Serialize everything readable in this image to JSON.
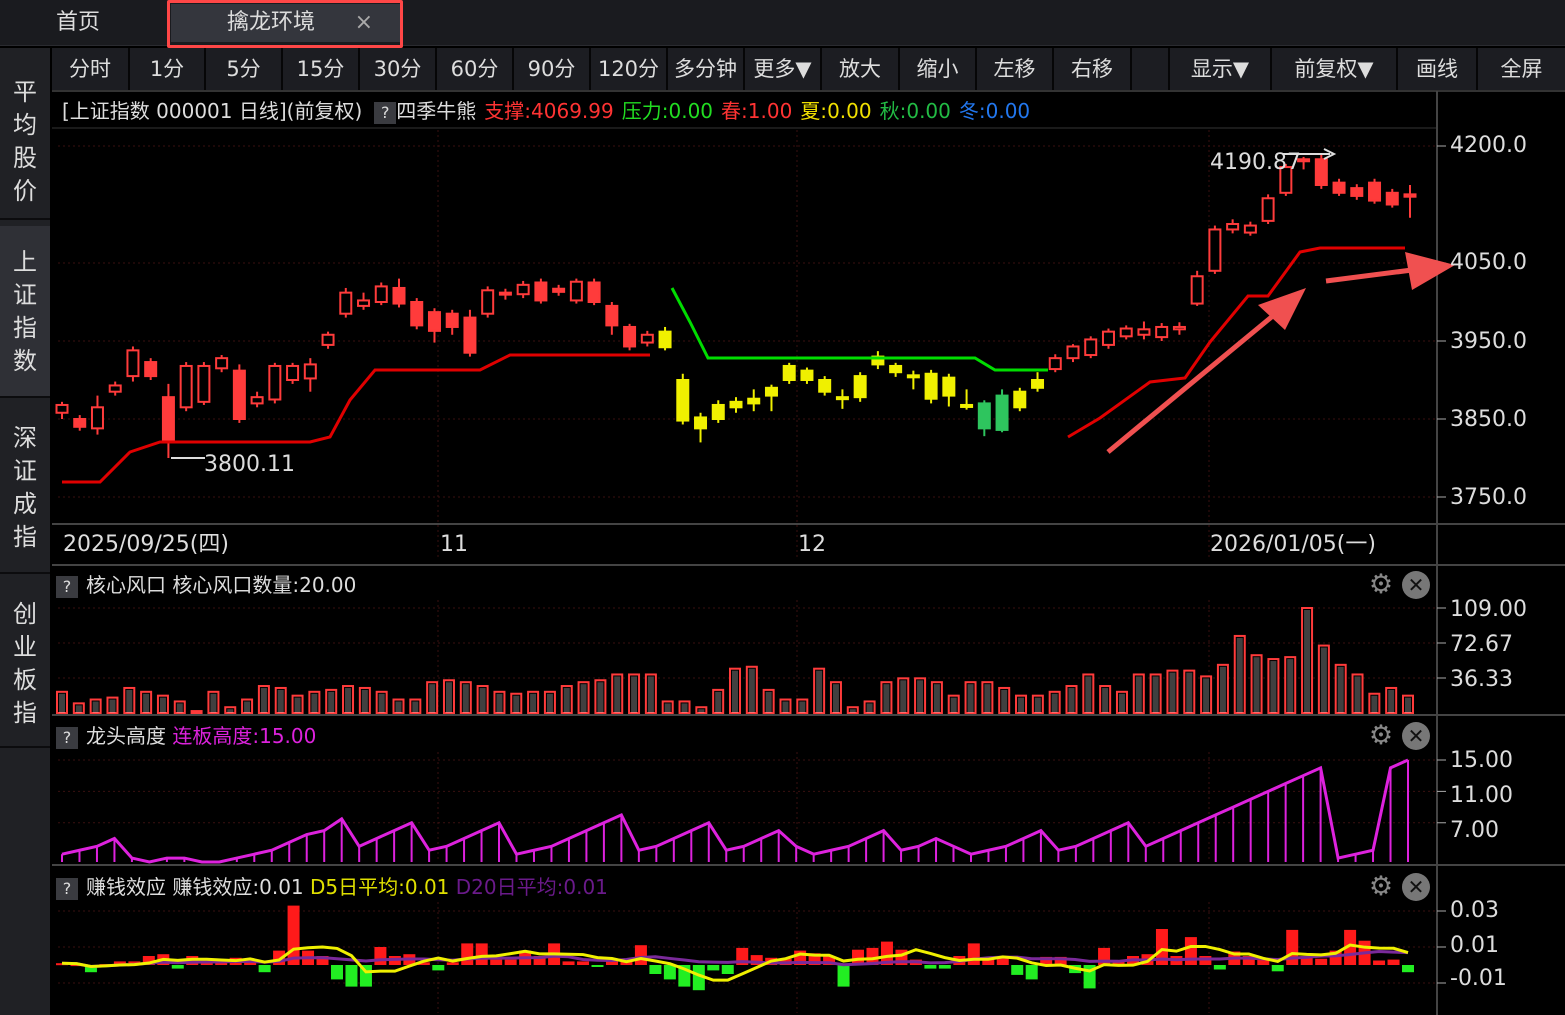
{
  "tabs": {
    "home": "首页",
    "active": "擒龙环境",
    "close": "×"
  },
  "sidebar": [
    {
      "label": "平均股价",
      "active": false
    },
    {
      "label": "上证指数",
      "active": true
    },
    {
      "label": "深证成指",
      "active": false
    },
    {
      "label": "创业板指",
      "active": false
    }
  ],
  "toolbar": [
    "分时",
    "1分",
    "5分",
    "15分",
    "30分",
    "60分",
    "90分",
    "120分",
    "多分钟",
    "更多▼",
    "放大",
    "缩小",
    "左移",
    "右移",
    "",
    "显示▼",
    "前复权▼",
    "画线",
    "全屏"
  ],
  "main": {
    "title": "[上证指数 000001 日线]",
    "adjust": "(前复权)",
    "indicator": "四季牛熊",
    "support_label": "支撑:",
    "support_value": "4069.99",
    "pressure_label": "压力:",
    "pressure_value": "0.00",
    "spring_label": "春:",
    "spring_value": "1.00",
    "summer_label": "夏:",
    "summer_value": "0.00",
    "autumn_label": "秋:",
    "autumn_value": "0.00",
    "winter_label": "冬:",
    "winter_value": "0.00",
    "y_ticks": [
      "4200.0",
      "4050.0",
      "3950.0",
      "3850.0",
      "3750.0"
    ],
    "high_annotation": "4190.87",
    "low_annotation": "3800.11",
    "dates": [
      "2025/09/25(四)",
      "11",
      "12",
      "2026/01/05(一)"
    ]
  },
  "panel_core": {
    "name": "核心风口",
    "label": "核心风口数量:",
    "value": "20.00",
    "y_ticks": [
      "109.00",
      "72.67",
      "36.33"
    ]
  },
  "panel_dragon": {
    "name": "龙头高度",
    "label": "连板高度:",
    "value": "15.00",
    "y_ticks": [
      "15.00",
      "11.00",
      "7.00"
    ]
  },
  "panel_money": {
    "name": "赚钱效应",
    "label": "赚钱效应:",
    "value": "0.01",
    "d5_label": "D5日平均:",
    "d5_value": "0.01",
    "d20_label": "D20日平均:",
    "d20_value": "0.01",
    "y_ticks": [
      "0.03",
      "0.01",
      "-0.01"
    ]
  },
  "colors": {
    "up": "#ff3b3b",
    "down": "#00e5e5",
    "yellow": "#f0f000",
    "green": "#2ec55e",
    "support": "#e00000",
    "pressure": "#00dd00",
    "magenta": "#dd22dd",
    "arrow": "#f05050"
  },
  "chart_data": [
    {
      "type": "candlestick",
      "title": "[上证指数 000001 日线]",
      "ylim": [
        3720,
        4230
      ],
      "y_ticks": [
        4200,
        4050,
        3950,
        3850,
        3750
      ],
      "dates": [
        "2025/09/25(四)",
        "11",
        "12",
        "2026/01/05(一)"
      ],
      "candles": [
        {
          "o": 3858,
          "c": 3868,
          "h": 3872,
          "l": 3850,
          "s": "up"
        },
        {
          "o": 3850,
          "c": 3840,
          "h": 3855,
          "l": 3835,
          "s": "down"
        },
        {
          "o": 3838,
          "c": 3865,
          "h": 3880,
          "l": 3830,
          "s": "up"
        },
        {
          "o": 3885,
          "c": 3893,
          "h": 3898,
          "l": 3880,
          "s": "up"
        },
        {
          "o": 3905,
          "c": 3938,
          "h": 3943,
          "l": 3898,
          "s": "up"
        },
        {
          "o": 3923,
          "c": 3905,
          "h": 3928,
          "l": 3900,
          "s": "down"
        },
        {
          "o": 3878,
          "c": 3820,
          "h": 3895,
          "l": 3800,
          "s": "down"
        },
        {
          "o": 3865,
          "c": 3918,
          "h": 3923,
          "l": 3860,
          "s": "up"
        },
        {
          "o": 3872,
          "c": 3918,
          "h": 3923,
          "l": 3868,
          "s": "up"
        },
        {
          "o": 3915,
          "c": 3928,
          "h": 3932,
          "l": 3910,
          "s": "up"
        },
        {
          "o": 3912,
          "c": 3850,
          "h": 3920,
          "l": 3845,
          "s": "down"
        },
        {
          "o": 3870,
          "c": 3878,
          "h": 3885,
          "l": 3865,
          "s": "up"
        },
        {
          "o": 3875,
          "c": 3918,
          "h": 3922,
          "l": 3870,
          "s": "up"
        },
        {
          "o": 3900,
          "c": 3918,
          "h": 3922,
          "l": 3895,
          "s": "up"
        },
        {
          "o": 3902,
          "c": 3920,
          "h": 3928,
          "l": 3885,
          "s": "up"
        },
        {
          "o": 3945,
          "c": 3958,
          "h": 3962,
          "l": 3940,
          "s": "up"
        },
        {
          "o": 3985,
          "c": 4012,
          "h": 4018,
          "l": 3980,
          "s": "up"
        },
        {
          "o": 3995,
          "c": 4002,
          "h": 4012,
          "l": 3990,
          "s": "up"
        },
        {
          "o": 4000,
          "c": 4020,
          "h": 4025,
          "l": 3996,
          "s": "up"
        },
        {
          "o": 4018,
          "c": 3998,
          "h": 4030,
          "l": 3993,
          "s": "down"
        },
        {
          "o": 4000,
          "c": 3970,
          "h": 4005,
          "l": 3965,
          "s": "down"
        },
        {
          "o": 3987,
          "c": 3963,
          "h": 3992,
          "l": 3948,
          "s": "down"
        },
        {
          "o": 3985,
          "c": 3968,
          "h": 3990,
          "l": 3958,
          "s": "down"
        },
        {
          "o": 3980,
          "c": 3935,
          "h": 3990,
          "l": 3930,
          "s": "up"
        },
        {
          "o": 3985,
          "c": 4015,
          "h": 4020,
          "l": 3980,
          "s": "up"
        },
        {
          "o": 4010,
          "c": 4012,
          "h": 4017,
          "l": 4003,
          "s": "up"
        },
        {
          "o": 4010,
          "c": 4022,
          "h": 4027,
          "l": 4005,
          "s": "up"
        },
        {
          "o": 4025,
          "c": 4002,
          "h": 4030,
          "l": 3998,
          "s": "down"
        },
        {
          "o": 4017,
          "c": 4013,
          "h": 4022,
          "l": 4008,
          "s": "up"
        },
        {
          "o": 4002,
          "c": 4026,
          "h": 4030,
          "l": 3998,
          "s": "up"
        },
        {
          "o": 4025,
          "c": 4000,
          "h": 4030,
          "l": 3996,
          "s": "down"
        },
        {
          "o": 3995,
          "c": 3970,
          "h": 4000,
          "l": 3958,
          "s": "down"
        },
        {
          "o": 3968,
          "c": 3943,
          "h": 3972,
          "l": 3938,
          "s": "down"
        },
        {
          "o": 3948,
          "c": 3958,
          "h": 3963,
          "l": 3943,
          "s": "up"
        },
        {
          "o": 3942,
          "c": 3962,
          "h": 3968,
          "l": 3938,
          "s": "yellow"
        },
        {
          "o": 3900,
          "c": 3848,
          "h": 3908,
          "l": 3843,
          "s": "yellow"
        },
        {
          "o": 3838,
          "c": 3852,
          "h": 3858,
          "l": 3820,
          "s": "yellow"
        },
        {
          "o": 3850,
          "c": 3868,
          "h": 3874,
          "l": 3845,
          "s": "yellow"
        },
        {
          "o": 3872,
          "c": 3865,
          "h": 3878,
          "l": 3858,
          "s": "yellow"
        },
        {
          "o": 3870,
          "c": 3876,
          "h": 3888,
          "l": 3860,
          "s": "yellow"
        },
        {
          "o": 3880,
          "c": 3890,
          "h": 3894,
          "l": 3860,
          "s": "yellow"
        },
        {
          "o": 3900,
          "c": 3918,
          "h": 3922,
          "l": 3895,
          "s": "yellow"
        },
        {
          "o": 3912,
          "c": 3900,
          "h": 3916,
          "l": 3895,
          "s": "yellow"
        },
        {
          "o": 3900,
          "c": 3885,
          "h": 3905,
          "l": 3880,
          "s": "yellow"
        },
        {
          "o": 3878,
          "c": 3876,
          "h": 3888,
          "l": 3863,
          "s": "yellow"
        },
        {
          "o": 3878,
          "c": 3905,
          "h": 3910,
          "l": 3872,
          "s": "yellow"
        },
        {
          "o": 3920,
          "c": 3930,
          "h": 3937,
          "l": 3914,
          "s": "yellow"
        },
        {
          "o": 3918,
          "c": 3910,
          "h": 3922,
          "l": 3904,
          "s": "yellow"
        },
        {
          "o": 3906,
          "c": 3906,
          "h": 3912,
          "l": 3888,
          "s": "yellow"
        },
        {
          "o": 3908,
          "c": 3876,
          "h": 3913,
          "l": 3870,
          "s": "yellow"
        },
        {
          "o": 3903,
          "c": 3880,
          "h": 3908,
          "l": 3866,
          "s": "yellow"
        },
        {
          "o": 3868,
          "c": 3868,
          "h": 3888,
          "l": 3862,
          "s": "yellow"
        },
        {
          "o": 3870,
          "c": 3838,
          "h": 3874,
          "l": 3828,
          "s": "green"
        },
        {
          "o": 3836,
          "c": 3880,
          "h": 3888,
          "l": 3833,
          "s": "green"
        },
        {
          "o": 3865,
          "c": 3885,
          "h": 3890,
          "l": 3860,
          "s": "yellow"
        },
        {
          "o": 3890,
          "c": 3900,
          "h": 3910,
          "l": 3885,
          "s": "yellow"
        },
        {
          "o": 3914,
          "c": 3928,
          "h": 3933,
          "l": 3910,
          "s": "up"
        },
        {
          "o": 3928,
          "c": 3943,
          "h": 3946,
          "l": 3923,
          "s": "up"
        },
        {
          "o": 3932,
          "c": 3952,
          "h": 3956,
          "l": 3928,
          "s": "up"
        },
        {
          "o": 3945,
          "c": 3962,
          "h": 3966,
          "l": 3940,
          "s": "up"
        },
        {
          "o": 3956,
          "c": 3966,
          "h": 3970,
          "l": 3952,
          "s": "up"
        },
        {
          "o": 3958,
          "c": 3965,
          "h": 3975,
          "l": 3952,
          "s": "up"
        },
        {
          "o": 3955,
          "c": 3968,
          "h": 3973,
          "l": 3950,
          "s": "up"
        },
        {
          "o": 3965,
          "c": 3968,
          "h": 3974,
          "l": 3958,
          "s": "up"
        },
        {
          "o": 3998,
          "c": 4033,
          "h": 4040,
          "l": 3995,
          "s": "up"
        },
        {
          "o": 4040,
          "c": 4093,
          "h": 4098,
          "l": 4036,
          "s": "up"
        },
        {
          "o": 4093,
          "c": 4100,
          "h": 4106,
          "l": 4088,
          "s": "up"
        },
        {
          "o": 4089,
          "c": 4098,
          "h": 4103,
          "l": 4085,
          "s": "up"
        },
        {
          "o": 4104,
          "c": 4133,
          "h": 4138,
          "l": 4100,
          "s": "up"
        },
        {
          "o": 4140,
          "c": 4173,
          "h": 4177,
          "l": 4136,
          "s": "up"
        },
        {
          "o": 4181,
          "c": 4183,
          "h": 4186,
          "l": 4170,
          "s": "up"
        },
        {
          "o": 4150,
          "c": 4183,
          "h": 4191,
          "l": 4145,
          "s": "down"
        },
        {
          "o": 4153,
          "c": 4140,
          "h": 4158,
          "l": 4136,
          "s": "down"
        },
        {
          "o": 4146,
          "c": 4136,
          "h": 4151,
          "l": 4131,
          "s": "up"
        },
        {
          "o": 4153,
          "c": 4130,
          "h": 4158,
          "l": 4126,
          "s": "down"
        },
        {
          "o": 4140,
          "c": 4125,
          "h": 4145,
          "l": 4121,
          "s": "up"
        },
        {
          "o": 4138,
          "c": 4135,
          "h": 4150,
          "l": 4108,
          "s": "up"
        }
      ]
    },
    {
      "type": "bar",
      "title": "核心风口",
      "ylim": [
        0,
        115
      ],
      "y_ticks": [
        109.0,
        72.67,
        36.33
      ],
      "values": [
        22,
        10,
        14,
        16,
        26,
        22,
        18,
        12,
        2,
        22,
        6,
        14,
        28,
        26,
        18,
        22,
        24,
        28,
        26,
        22,
        14,
        14,
        32,
        34,
        32,
        28,
        22,
        20,
        22,
        22,
        28,
        32,
        34,
        40,
        40,
        40,
        12,
        12,
        6,
        24,
        46,
        48,
        24,
        14,
        14,
        46,
        32,
        6,
        12,
        32,
        36,
        36,
        32,
        18,
        32,
        32,
        26,
        18,
        18,
        22,
        28,
        40,
        28,
        22,
        40,
        40,
        44,
        44,
        38,
        50,
        80,
        60,
        56,
        58,
        109,
        70,
        50,
        40,
        20,
        26,
        18
      ]
    },
    {
      "type": "line",
      "title": "龙头高度",
      "ylim": [
        2,
        16
      ],
      "y_ticks": [
        15.0,
        11.0,
        7.0
      ],
      "values": [
        3,
        3.5,
        4,
        5,
        2.5,
        2,
        2.5,
        2.5,
        2,
        2,
        2.5,
        3,
        3.5,
        4.5,
        5.5,
        6,
        7.5,
        4,
        5,
        6,
        7,
        3.5,
        4,
        5,
        6,
        7,
        3,
        3.5,
        4,
        5,
        6,
        7,
        8,
        3.5,
        4,
        5,
        6,
        7,
        3.5,
        4,
        5,
        6,
        4,
        3,
        3.5,
        4,
        5,
        6,
        3.5,
        4,
        5,
        4,
        3,
        3.5,
        4,
        5,
        6,
        3.5,
        4,
        5,
        6,
        7,
        4,
        5,
        6,
        7,
        8,
        9,
        10,
        11,
        12,
        13,
        14,
        2.5,
        3,
        3.5,
        14,
        15
      ]
    },
    {
      "type": "bar",
      "title": "赚钱效应",
      "ylim": [
        -0.018,
        0.035
      ],
      "y_ticks": [
        0.03,
        0.01,
        -0.01
      ],
      "values": [
        0.001,
        0.0005,
        -0.004,
        0.0005,
        0.002,
        0.002,
        0.005,
        0.006,
        -0.002,
        0.005,
        0.002,
        0.003,
        0.004,
        0.003,
        -0.004,
        0.008,
        0.033,
        0.008,
        0.005,
        -0.008,
        -0.012,
        -0.012,
        0.01,
        0.005,
        0.006,
        0.0015,
        -0.003,
        0.0015,
        0.012,
        0.012,
        0.003,
        0.003,
        0.008,
        0.005,
        0.012,
        0.002,
        0.002,
        -0.0005,
        0.0025,
        0.003,
        0.011,
        -0.005,
        -0.008,
        -0.012,
        -0.014,
        -0.003,
        -0.005,
        0.0095,
        0.0055,
        0.004,
        0.0035,
        0.008,
        0.0065,
        0.005,
        -0.012,
        0.0085,
        0.0095,
        0.013,
        0.0085,
        0.003,
        -0.002,
        -0.002,
        0.005,
        0.012,
        0.003,
        0.0045,
        -0.0055,
        -0.008,
        0.0045,
        0.0045,
        -0.0045,
        -0.013,
        0.0095,
        0.0025,
        0.005,
        0.006,
        0.02,
        0.005,
        0.0155,
        0.005,
        -0.0025,
        0.0075,
        0.005,
        0.0035,
        -0.0035,
        0.0195,
        0.005,
        0.0035,
        0.008,
        0.0195,
        0.0135,
        0.0025,
        0.003,
        -0.004
      ]
    }
  ]
}
